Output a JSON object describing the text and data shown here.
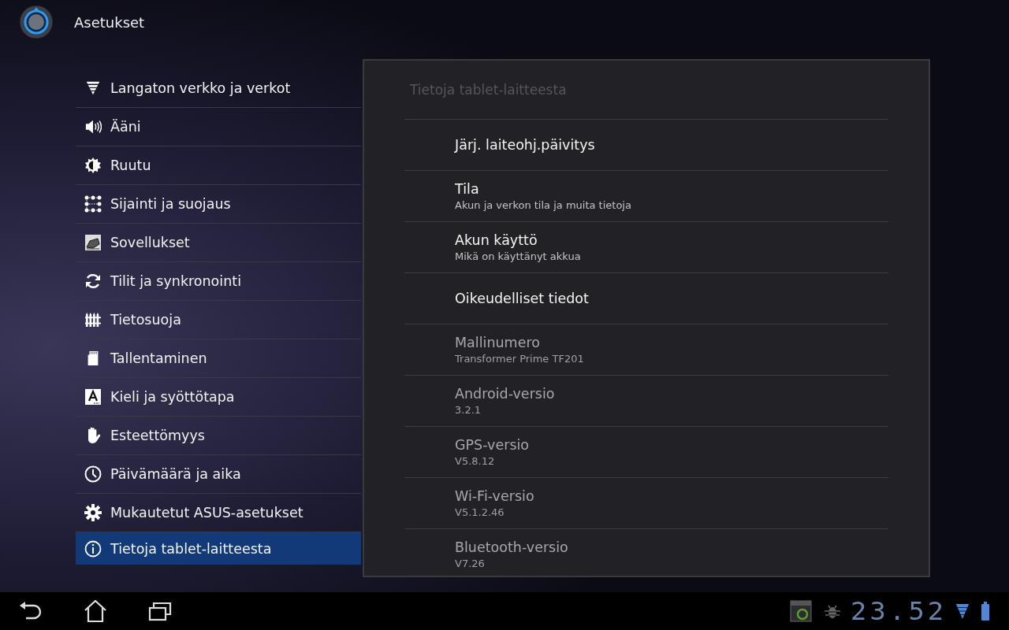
{
  "app_bar": {
    "title": "Asetukset"
  },
  "sidebar": {
    "items": [
      {
        "label": "Langaton verkko ja verkot",
        "kind": "wireless",
        "selected": false
      },
      {
        "label": "Ääni",
        "kind": "sound",
        "selected": false
      },
      {
        "label": "Ruutu",
        "kind": "display",
        "selected": false
      },
      {
        "label": "Sijainti ja suojaus",
        "kind": "location",
        "selected": false
      },
      {
        "label": "Sovellukset",
        "kind": "apps",
        "selected": false
      },
      {
        "label": "Tilit ja synkronointi",
        "kind": "sync",
        "selected": false
      },
      {
        "label": "Tietosuoja",
        "kind": "privacy",
        "selected": false
      },
      {
        "label": "Tallentaminen",
        "kind": "storage",
        "selected": false
      },
      {
        "label": "Kieli ja syöttötapa",
        "kind": "language",
        "selected": false
      },
      {
        "label": "Esteettömyys",
        "kind": "accessibility",
        "selected": false
      },
      {
        "label": "Päivämäärä ja aika",
        "kind": "clock",
        "selected": false
      },
      {
        "label": "Mukautetut ASUS-asetukset",
        "kind": "gear",
        "selected": false
      },
      {
        "label": "Tietoja tablet-laitteesta",
        "kind": "info",
        "selected": true
      }
    ]
  },
  "panel": {
    "title": "Tietoja tablet-laitteesta",
    "rows": [
      {
        "title": "Järj. laiteohj.päivitys",
        "disabled": false
      },
      {
        "title": "Tila",
        "summary": "Akun ja verkon tila ja muita tietoja",
        "disabled": false
      },
      {
        "title": "Akun käyttö",
        "summary": "Mikä on käyttänyt akkua",
        "disabled": false
      },
      {
        "title": "Oikeudelliset tiedot",
        "disabled": false
      },
      {
        "title": "Mallinumero",
        "summary": "Transformer Prime TF201",
        "disabled": true
      },
      {
        "title": "Android-versio",
        "summary": "3.2.1",
        "disabled": true
      },
      {
        "title": "GPS-versio",
        "summary": "V5.8.12",
        "disabled": true
      },
      {
        "title": "Wi-Fi-versio",
        "summary": "V5.1.2.46",
        "disabled": true
      },
      {
        "title": "Bluetooth-versio",
        "summary": "V7.26",
        "disabled": true
      }
    ]
  },
  "system_bar": {
    "clock": "23.52"
  }
}
